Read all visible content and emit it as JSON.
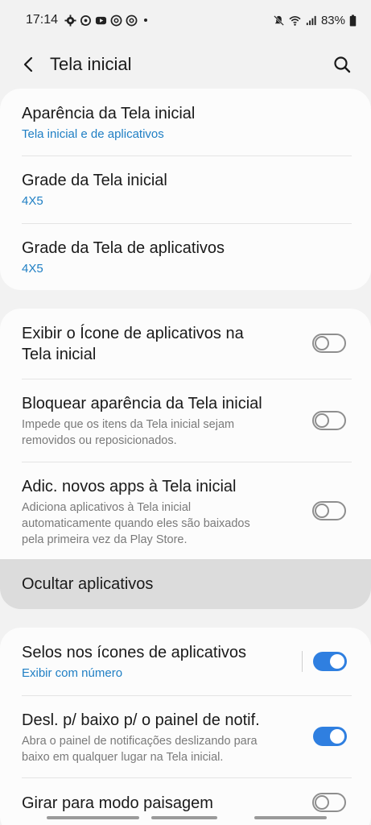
{
  "status_bar": {
    "time": "17:14",
    "battery": "83%",
    "left_icons": [
      "gear-icon",
      "whatsapp-icon",
      "youtube-icon",
      "chrome-icon",
      "chrome-icon"
    ],
    "right_icons": [
      "mute-icon",
      "wifi-icon",
      "signal-icon",
      "battery-icon"
    ]
  },
  "appbar": {
    "title": "Tela inicial",
    "back_icon": "back-arrow-icon",
    "search_icon": "search-icon"
  },
  "group1": [
    {
      "title": "Aparência da Tela inicial",
      "subtitle": "Tela inicial e de aplicativos"
    },
    {
      "title": "Grade da Tela inicial",
      "subtitle": "4X5"
    },
    {
      "title": "Grade da Tela de aplicativos",
      "subtitle": "4X5"
    }
  ],
  "group2": [
    {
      "title_line1": "Exibir o Ícone de aplicativos na",
      "title_line2": "Tela inicial",
      "toggle": "off"
    },
    {
      "title": "Bloquear aparência da Tela inicial",
      "desc_line1": "Impede que os itens da Tela inicial sejam",
      "desc_line2": "removidos ou reposicionados.",
      "toggle": "off"
    },
    {
      "title": "Adic. novos apps à Tela inicial",
      "desc_line1": "Adiciona aplicativos à Tela inicial",
      "desc_line2": "automaticamente quando eles são baixados",
      "desc_line3": "pela primeira vez da Play Store.",
      "toggle": "off"
    }
  ],
  "hide_apps": {
    "label": "Ocultar aplicativos"
  },
  "group3": [
    {
      "title": "Selos nos ícones de aplicativos",
      "subtitle": "Exibir com número",
      "toggle": "on"
    },
    {
      "title": "Desl. p/ baixo p/ o painel de notif.",
      "desc_line1": "Abra o painel de notificações deslizando para",
      "desc_line2": "baixo em qualquer lugar na Tela inicial.",
      "toggle": "on"
    },
    {
      "title": "Girar para modo paisagem",
      "toggle": "off"
    }
  ],
  "colors": {
    "accent_blue": "#1f7fc4",
    "toggle_on": "#2f7fe0",
    "background": "#f2f2f2",
    "card": "#fcfcfc"
  }
}
